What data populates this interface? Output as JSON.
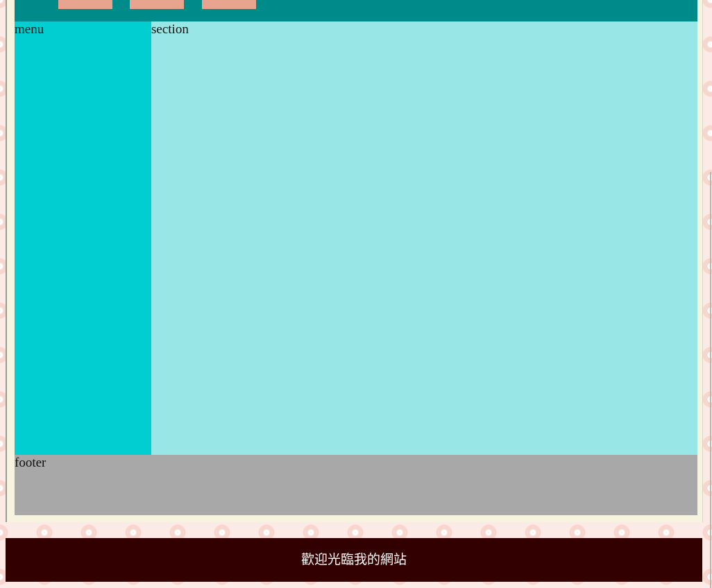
{
  "colors": {
    "header_bg": "#008b8b",
    "nav_link_bg": "#e9a48f",
    "menu_bg": "#00ced1",
    "section_bg": "#98e6e6",
    "footer_bg": "#a8a8a8",
    "frame_bg": "#f6f4df",
    "banner_bg": "#330000",
    "banner_text": "#ffffff",
    "page_bg": "#fbeae6"
  },
  "header": {
    "nav_links": [
      "",
      "",
      ""
    ]
  },
  "menu": {
    "label": "menu"
  },
  "section": {
    "label": "section"
  },
  "footer": {
    "label": "footer"
  },
  "banner": {
    "text": "歡迎光臨我的網站"
  }
}
